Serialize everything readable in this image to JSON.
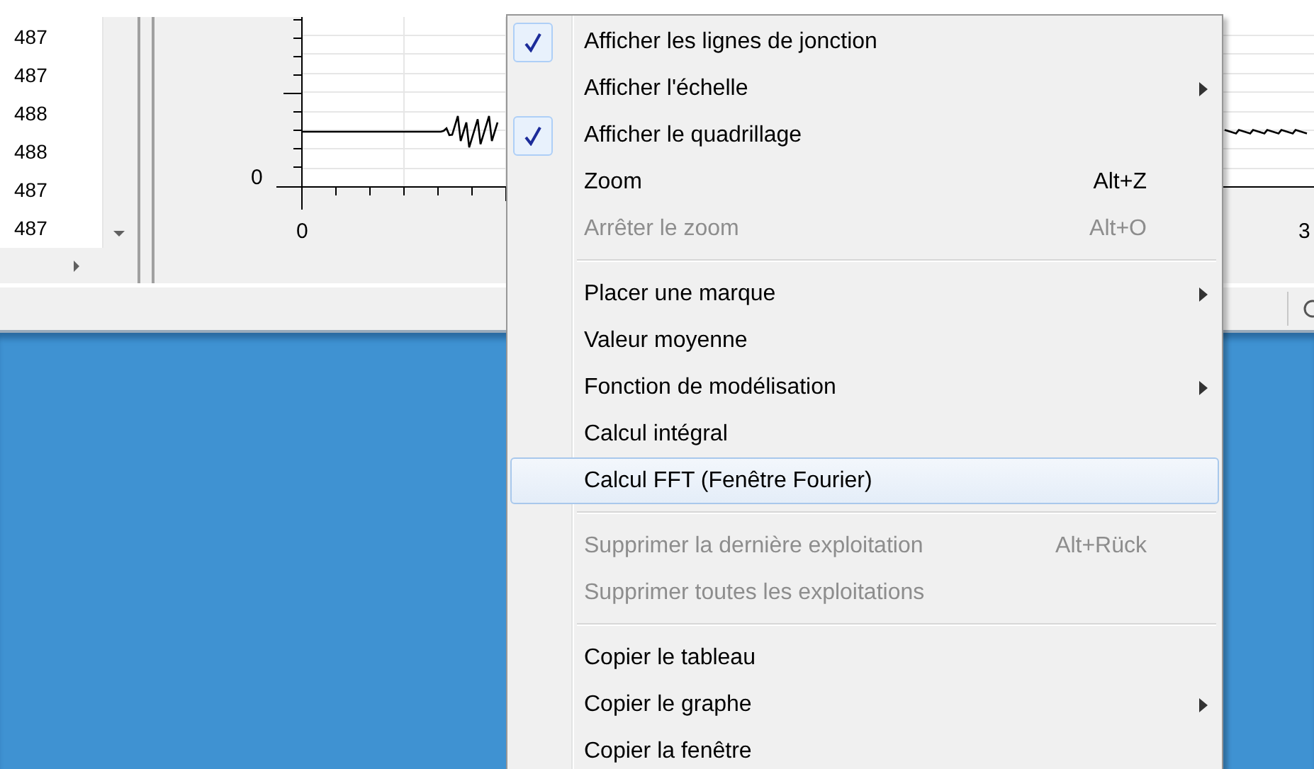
{
  "table": {
    "rows": [
      "487",
      "487",
      "488",
      "488",
      "487",
      "487"
    ]
  },
  "graph": {
    "y_axis_label": "0",
    "x_axis_labels": [
      "0",
      "3"
    ]
  },
  "context_menu": {
    "items": [
      {
        "kind": "item",
        "label": "Afficher les lignes de jonction",
        "checked": true,
        "disabled": false,
        "selected": false,
        "submenu": false
      },
      {
        "kind": "item",
        "label": "Afficher l'échelle",
        "checked": false,
        "disabled": false,
        "selected": false,
        "submenu": true
      },
      {
        "kind": "item",
        "label": "Afficher le quadrillage",
        "checked": true,
        "disabled": false,
        "selected": false,
        "submenu": false
      },
      {
        "kind": "item",
        "label": "Zoom",
        "shortcut": "Alt+Z",
        "checked": false,
        "disabled": false,
        "selected": false,
        "submenu": false
      },
      {
        "kind": "item",
        "label": "Arrêter le zoom",
        "shortcut": "Alt+O",
        "checked": false,
        "disabled": true,
        "selected": false,
        "submenu": false
      },
      {
        "kind": "separator"
      },
      {
        "kind": "item",
        "label": "Placer une marque",
        "checked": false,
        "disabled": false,
        "selected": false,
        "submenu": true
      },
      {
        "kind": "item",
        "label": "Valeur moyenne",
        "checked": false,
        "disabled": false,
        "selected": false,
        "submenu": false
      },
      {
        "kind": "item",
        "label": "Fonction de modélisation",
        "checked": false,
        "disabled": false,
        "selected": false,
        "submenu": true
      },
      {
        "kind": "item",
        "label": "Calcul intégral",
        "checked": false,
        "disabled": false,
        "selected": false,
        "submenu": false
      },
      {
        "kind": "item",
        "label": "Calcul FFT (Fenêtre Fourier)",
        "checked": false,
        "disabled": false,
        "selected": true,
        "submenu": false
      },
      {
        "kind": "separator"
      },
      {
        "kind": "item",
        "label": "Supprimer la dernière exploitation",
        "shortcut": "Alt+Rück",
        "checked": false,
        "disabled": true,
        "selected": false,
        "submenu": false
      },
      {
        "kind": "item",
        "label": "Supprimer toutes les exploitations",
        "checked": false,
        "disabled": true,
        "selected": false,
        "submenu": false
      },
      {
        "kind": "separator"
      },
      {
        "kind": "item",
        "label": "Copier le tableau",
        "checked": false,
        "disabled": false,
        "selected": false,
        "submenu": false
      },
      {
        "kind": "item",
        "label": "Copier le graphe",
        "checked": false,
        "disabled": false,
        "selected": false,
        "submenu": true
      },
      {
        "kind": "item",
        "label": "Copier la fenêtre",
        "checked": false,
        "disabled": false,
        "selected": false,
        "submenu": false
      }
    ]
  }
}
